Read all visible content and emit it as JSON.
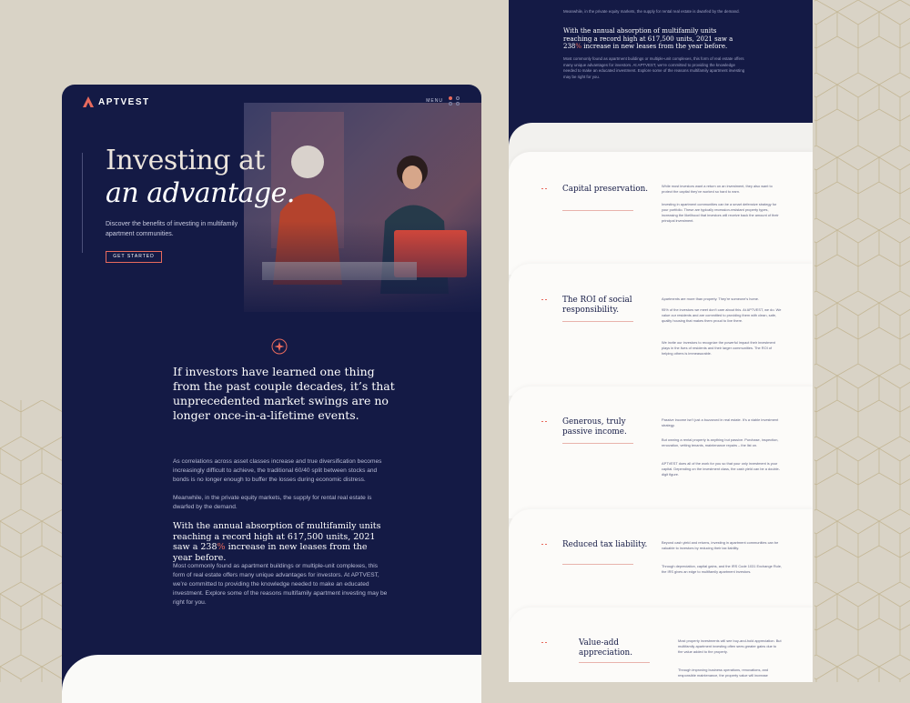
{
  "brand": {
    "name": "APTVEST"
  },
  "nav": {
    "menu_label": "MENU"
  },
  "hero": {
    "title_line1": "Investing at",
    "title_line2": "an advantage.",
    "subtitle": "Discover the benefits of investing in multifamily apartment communities.",
    "cta": "GET STARTED"
  },
  "intro": {
    "quote": "If investors have learned one thing from the past couple decades, it’s that unprecedented market swings are no longer once-in-a-lifetime events.",
    "para1": "As correlations across asset classes increase and true diversification becomes increasingly difficult to achieve, the traditional 60/40 split between stocks and bonds is no longer enough to buffer the losses during economic distress.",
    "para2": "Meanwhile, in the private equity markets, the supply for rental real estate is dwarfed by the demand.",
    "stat_before": "With the annual absorption of multifamily units reaching a record high at 617,500 units, 2021 saw a 238",
    "stat_accent": "%",
    "stat_after": " increase in new leases from the year before.",
    "para3": "Most commonly found as apartment buildings or multiple-unit complexes, this form of real estate offers many unique advantages for investors. At APTVEST, we’re committed to providing the knowledge needed to make an educated investment. Explore some of the reasons multifamily apartment investing may be right for you."
  },
  "cards": [
    {
      "title": "Capital preservation.",
      "paragraphs": [
        "While most investors want a return on an investment, they also want to protect the capital they’ve worked so hard to earn.",
        "Investing in apartment communities can be a smart defensive strategy for your portfolio. These are typically recession-resistant property types, increasing the likelihood that investors will receive back the amount of their principal investment."
      ]
    },
    {
      "title": "The ROI of social responsibility.",
      "paragraphs": [
        "Apartments are more than property. They’re someone’s home.",
        "95% of the investors we meet don’t care about this. At APTVEST, we do. We value our residents and are committed to providing them with clean, safe, quality housing that makes them proud to live there.",
        "We invite our investors to recognize the powerful impact their investment plays in the lives of residents and their larger communities. The ROI of helping others is immeasurable."
      ]
    },
    {
      "title": "Generous, truly passive income.",
      "paragraphs": [
        "Passive income isn’t just a buzzword in real estate. It’s a viable investment strategy.",
        "But owning a rental property is anything but passive. Purchase, inspection, renovation, vetting tenants, maintenance repairs – the list on.",
        "APTVEST does all of the work for you so that your only investment is your capital. Depending on the investment class, the cash yield can be a double-digit figure."
      ]
    },
    {
      "title": "Reduced tax liability.",
      "paragraphs": [
        "Beyond cash yield and returns, investing in apartment communities can be valuable to investors by reducing their tax liability.",
        "Through depreciation, capital gains, and the IRS Code 1031 Exchange Rule, the IRS gives an edge to multifamily apartment investors."
      ]
    },
    {
      "title": "Value-add appreciation.",
      "paragraphs": [
        "Most property investments will see buy-and-hold appreciation. But multifamily apartment investing often sees greater gains due to the value added to the property.",
        "Through improving business operations, renovations, and responsible maintenance, the property value will increase"
      ]
    }
  ],
  "colors": {
    "navy": "#141a45",
    "accent": "#e86a5d",
    "cream": "#fcfbf9",
    "background": "#d9d3c6"
  }
}
